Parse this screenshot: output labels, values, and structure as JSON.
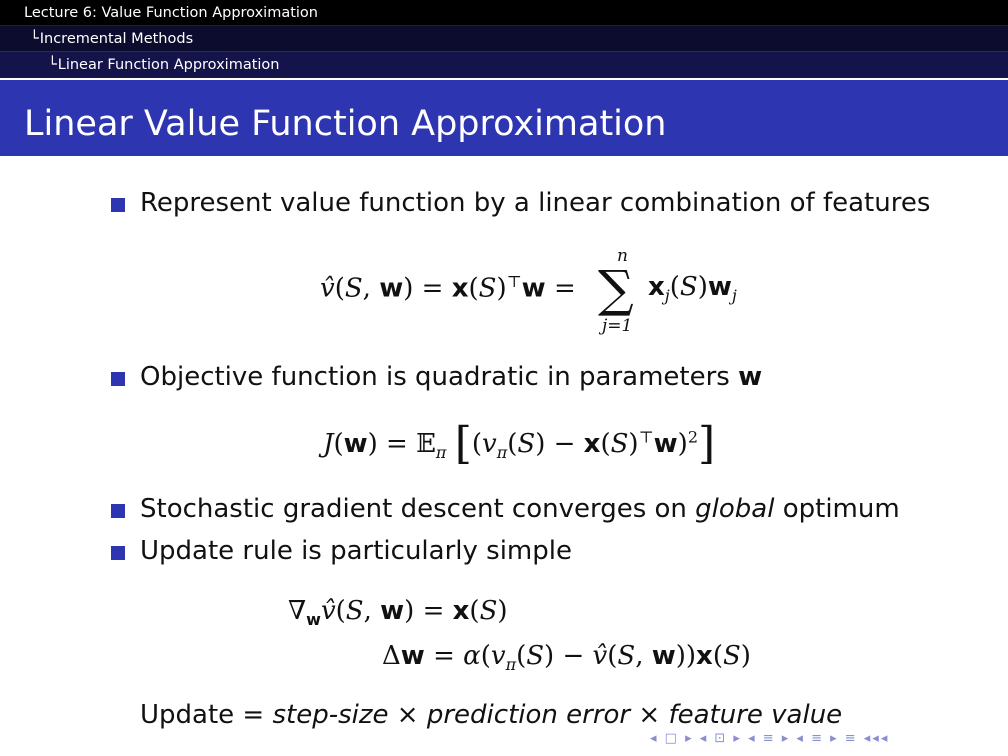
{
  "breadcrumbs": {
    "lecture": "Lecture 6: Value Function Approximation",
    "section": "Incremental Methods",
    "subsection": "Linear Function Approximation"
  },
  "slide": {
    "title": "Linear Value Function Approximation",
    "bullets": [
      "Represent value function by a linear combination of features",
      "Objective function is quadratic in parameters",
      "Stochastic gradient descent converges on",
      "Update rule is particularly simple"
    ],
    "bullet2_bold": "w",
    "bullet3_italic": "global",
    "bullet3_tail": "optimum",
    "update_line": {
      "prefix": "Update =",
      "step_size": "step-size",
      "times": "×",
      "prediction_error": "prediction error",
      "feature_value": "feature value"
    }
  },
  "colors": {
    "title_bar": "#2e35b0",
    "bullet": "#2e35b0",
    "nav_symbols": "#8a8fcf"
  },
  "navigation": {
    "symbols": "◂ □ ▸ ◂ ⊡ ▸ ◂ ≡ ▸ ◂ ≡ ▸   ≡   ◂◂◂"
  }
}
